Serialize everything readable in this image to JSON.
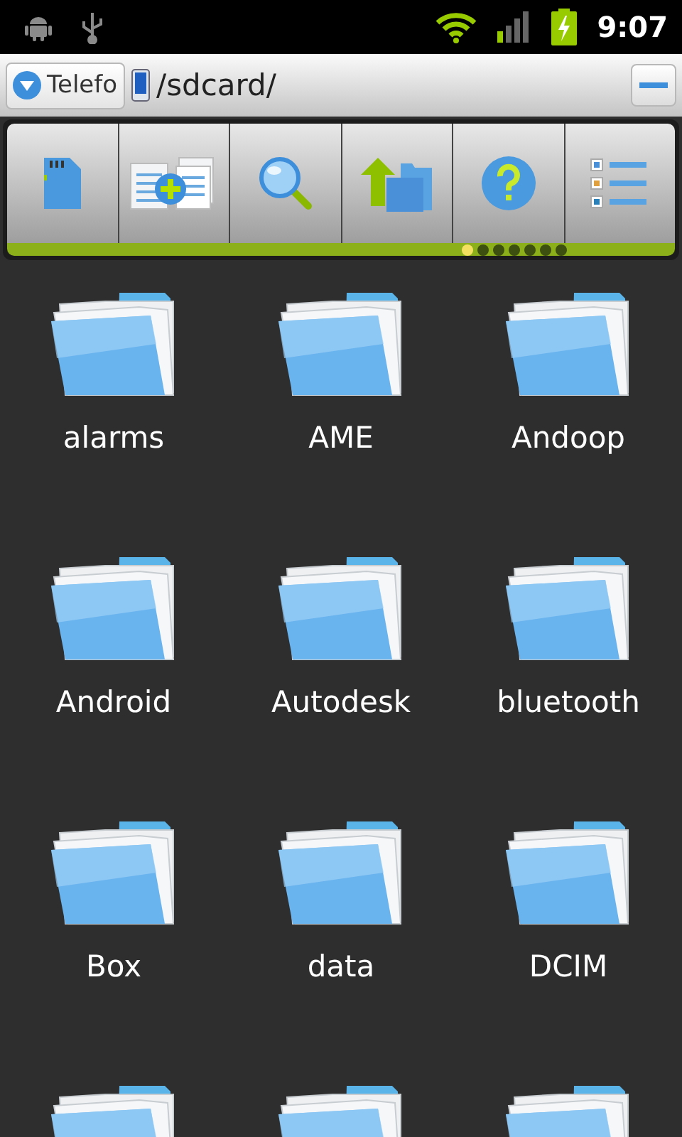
{
  "status_bar": {
    "time": "9:07"
  },
  "location_bar": {
    "storage": "Telefo",
    "path": "/sdcard/"
  },
  "toolbar": {
    "buttons": [
      {
        "kind": "sdcard"
      },
      {
        "kind": "copy"
      },
      {
        "kind": "search"
      },
      {
        "kind": "up"
      },
      {
        "kind": "help"
      },
      {
        "kind": "list"
      }
    ],
    "page_dots": [
      {
        "selected": true
      },
      {
        "selected": false
      },
      {
        "selected": false
      },
      {
        "selected": false
      },
      {
        "selected": false
      },
      {
        "selected": false
      },
      {
        "selected": false
      }
    ]
  },
  "folders": [
    {
      "kind": "named",
      "name": "alarms"
    },
    {
      "kind": "named",
      "name": "AME"
    },
    {
      "kind": "named",
      "name": "Andoop"
    },
    {
      "kind": "named",
      "name": "Android"
    },
    {
      "kind": "named",
      "name": "Autodesk"
    },
    {
      "kind": "named",
      "name": "bluetooth"
    },
    {
      "kind": "named",
      "name": "Box"
    },
    {
      "kind": "named",
      "name": "data"
    },
    {
      "kind": "named",
      "name": "DCIM"
    },
    {
      "kind": "cut_off"
    },
    {
      "kind": "cut_off"
    },
    {
      "kind": "cut_off"
    }
  ]
}
